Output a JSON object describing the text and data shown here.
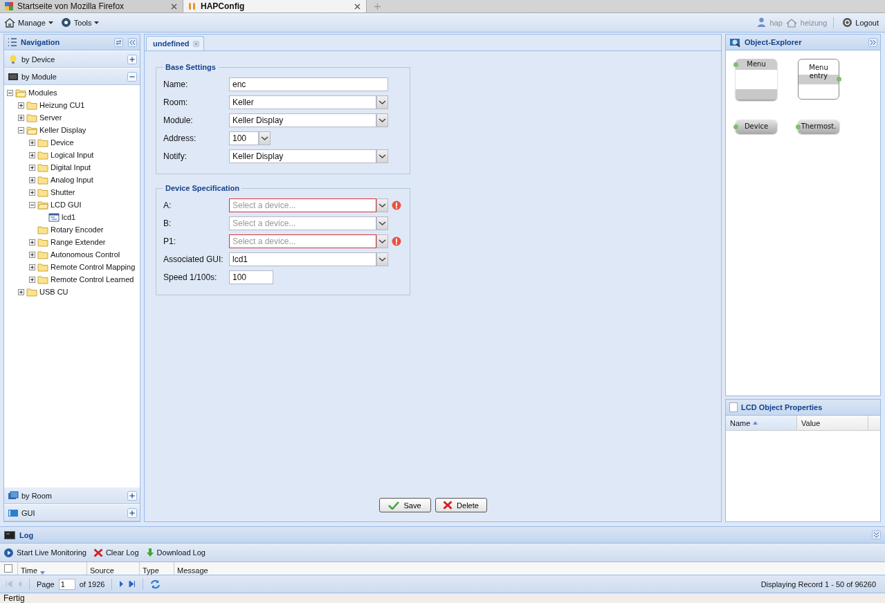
{
  "browser_tabs": [
    {
      "title": "Startseite von Mozilla Firefox",
      "selected": false
    },
    {
      "title": "HAPConfig",
      "selected": true
    }
  ],
  "toolbar": {
    "menus": [
      "Manage",
      "Tools"
    ],
    "user": "hap",
    "location": "heizung",
    "logout": "Logout"
  },
  "navigation": {
    "title": "Navigation",
    "sections": [
      {
        "label": "by Device",
        "expanded": false
      },
      {
        "label": "by Module",
        "expanded": true,
        "tree": [
          {
            "label": "Modules",
            "kind": "folder",
            "expanded": true,
            "children": [
              {
                "label": "Heizung CU1",
                "kind": "folder",
                "expanded": false
              },
              {
                "label": "Server",
                "kind": "folder",
                "expanded": false
              },
              {
                "label": "Keller Display",
                "kind": "folder",
                "expanded": true,
                "children": [
                  {
                    "label": "Device",
                    "kind": "folder",
                    "expanded": false
                  },
                  {
                    "label": "Logical Input",
                    "kind": "folder",
                    "expanded": false
                  },
                  {
                    "label": "Digital Input",
                    "kind": "folder",
                    "expanded": false
                  },
                  {
                    "label": "Analog Input",
                    "kind": "folder",
                    "expanded": false
                  },
                  {
                    "label": "Shutter",
                    "kind": "folder",
                    "expanded": false
                  },
                  {
                    "label": "LCD GUI",
                    "kind": "folder",
                    "expanded": true,
                    "children": [
                      {
                        "label": "lcd1",
                        "kind": "item"
                      }
                    ]
                  },
                  {
                    "label": "Rotary Encoder",
                    "kind": "folder"
                  },
                  {
                    "label": "Range Extender",
                    "kind": "folder",
                    "expanded": false
                  },
                  {
                    "label": "Autonomous Control",
                    "kind": "folder",
                    "expanded": false
                  },
                  {
                    "label": "Remote Control Mapping",
                    "kind": "folder",
                    "expanded": false
                  },
                  {
                    "label": "Remote Control Learned",
                    "kind": "folder",
                    "expanded": false
                  }
                ]
              },
              {
                "label": "USB CU",
                "kind": "folder",
                "expanded": false
              }
            ]
          }
        ]
      },
      {
        "label": "by Room",
        "expanded": false
      },
      {
        "label": "GUI",
        "expanded": false
      }
    ]
  },
  "editor": {
    "tabs": [
      {
        "label": "undefined",
        "selected": true
      }
    ],
    "fieldsets": [
      {
        "title": "Base Settings",
        "fields": [
          {
            "label": "Name:",
            "kind": "text",
            "value": "enc",
            "invalid": false
          },
          {
            "label": "Room:",
            "kind": "combo",
            "value": "Keller",
            "invalid": false
          },
          {
            "label": "Module:",
            "kind": "combo",
            "value": "Keller Display",
            "invalid": false
          },
          {
            "label": "Address:",
            "kind": "short-combo",
            "value": "100",
            "invalid": false
          },
          {
            "label": "Notify:",
            "kind": "combo",
            "value": "Keller Display",
            "invalid": false
          }
        ]
      },
      {
        "title": "Device Specification",
        "fields": [
          {
            "label": "A:",
            "kind": "combo",
            "placeholder": "Select a device...",
            "invalid": true
          },
          {
            "label": "B:",
            "kind": "combo",
            "placeholder": "Select a device...",
            "invalid": false
          },
          {
            "label": "P1:",
            "kind": "combo",
            "placeholder": "Select a device...",
            "invalid": true
          },
          {
            "label": "Associated GUI:",
            "kind": "combo",
            "value": "lcd1",
            "invalid": false
          },
          {
            "label": "Speed 1/100s:",
            "kind": "short-text",
            "value": "100",
            "invalid": false
          }
        ]
      }
    ],
    "buttons": [
      {
        "label": "Save",
        "kind": "save"
      },
      {
        "label": "Delete",
        "kind": "delete"
      }
    ]
  },
  "object_explorer": {
    "title": "Object-Explorer",
    "objects": [
      {
        "label": "Menu",
        "kind": "container"
      },
      {
        "label": "Menu entry",
        "kind": "entry"
      },
      {
        "label": "Device",
        "kind": "pill"
      },
      {
        "label": "Thermost.",
        "kind": "pill"
      }
    ]
  },
  "lcd_properties": {
    "title": "LCD Object Properties",
    "columns": [
      {
        "label": "Name",
        "sorted": true,
        "ascending": true
      },
      {
        "label": "Value",
        "sorted": false
      }
    ]
  },
  "log": {
    "title": "Log",
    "actions": [
      {
        "label": "Start Live Monitoring",
        "kind": "play"
      },
      {
        "label": "Clear Log",
        "kind": "clear"
      },
      {
        "label": "Download Log",
        "kind": "download"
      }
    ],
    "select_all_checked": false,
    "columns": [
      {
        "label": "Time",
        "sorted": true,
        "ascending": false
      },
      {
        "label": "Source",
        "sorted": false
      },
      {
        "label": "Type",
        "sorted": false
      },
      {
        "label": "Message",
        "sorted": false
      }
    ],
    "pager": {
      "page_label": "Page",
      "page": "1",
      "page_count": "of 1926",
      "summary": "Displaying Record 1 - 50 of 96260"
    }
  },
  "status_bar": "Fertig"
}
